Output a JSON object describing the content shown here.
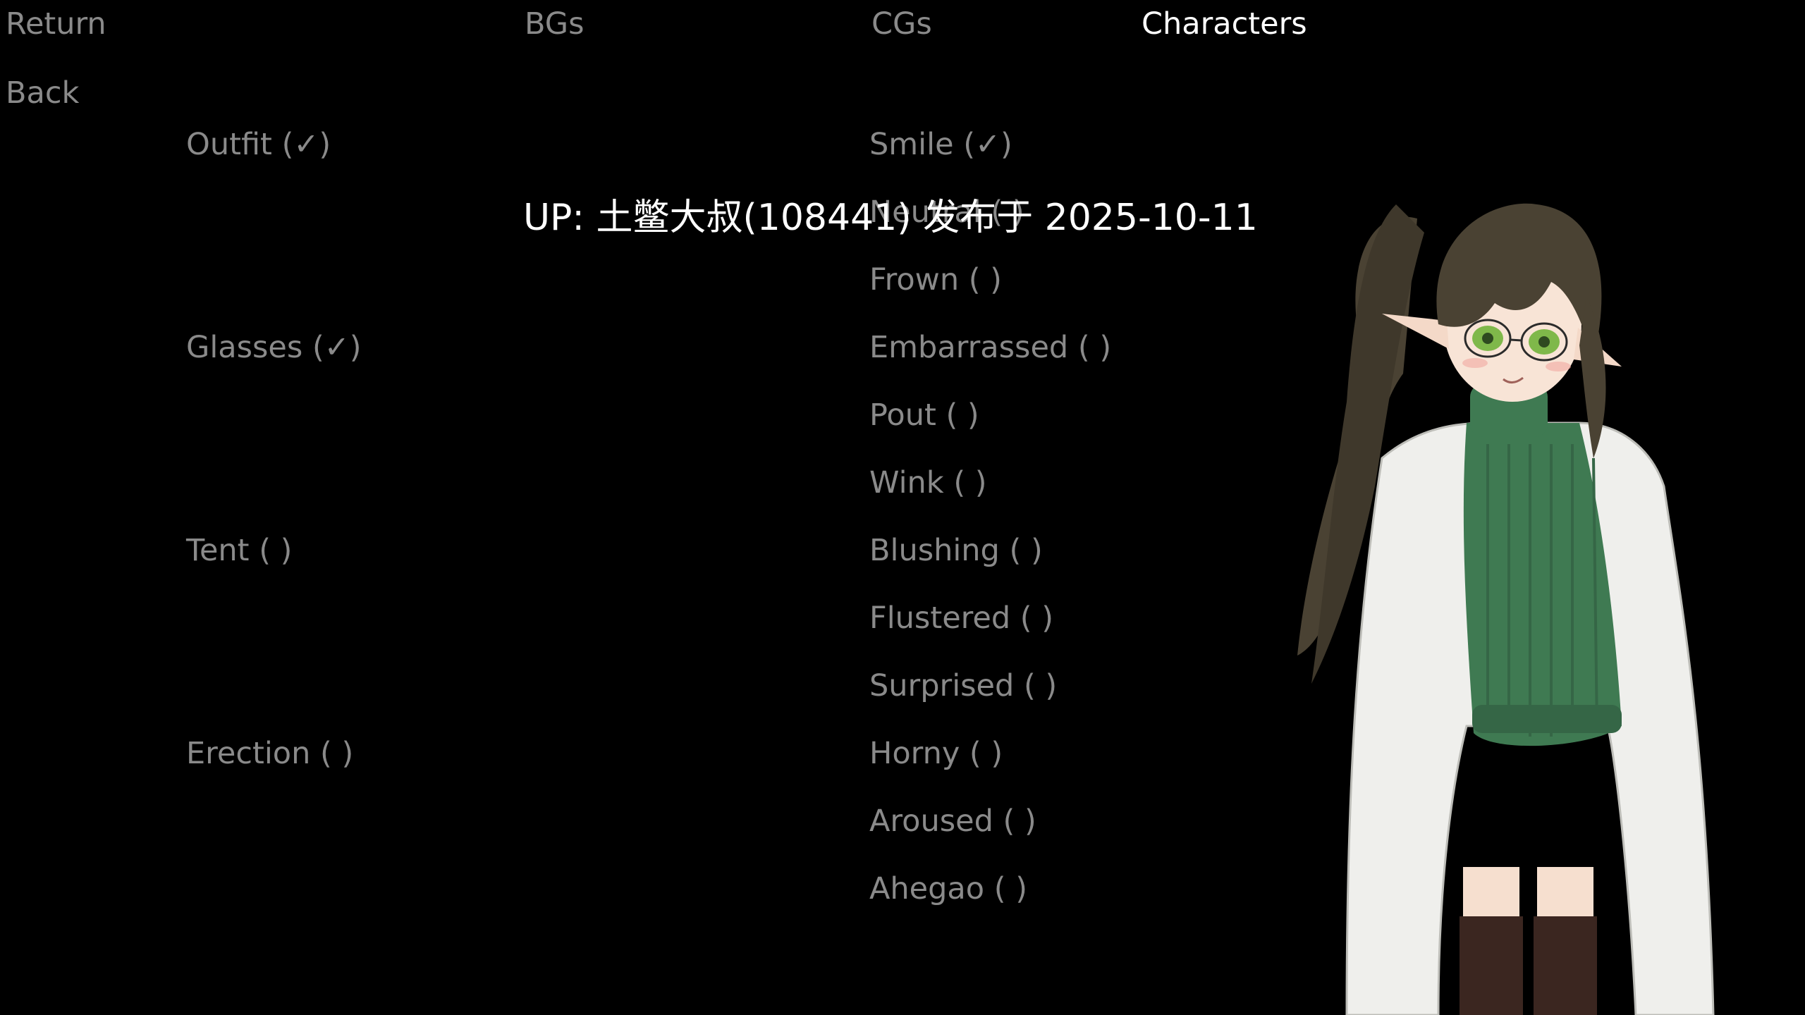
{
  "nav": {
    "return": "Return",
    "bgs": "BGs",
    "cgs": "CGs",
    "characters": "Characters"
  },
  "back": "Back",
  "attributes": [
    {
      "label": "Outfit (✓)"
    },
    {
      "label": "Glasses (✓)"
    },
    {
      "label": "Tent (  )"
    },
    {
      "label": "Erection (  )"
    }
  ],
  "expressions": [
    {
      "label": "Smile (✓)"
    },
    {
      "label": "Neutral (  )"
    },
    {
      "label": "Frown (  )"
    },
    {
      "label": "Embarrassed (  )"
    },
    {
      "label": "Pout (  )"
    },
    {
      "label": "Wink (  )"
    },
    {
      "label": "Blushing (  )"
    },
    {
      "label": "Flustered (  )"
    },
    {
      "label": "Surprised (  )"
    },
    {
      "label": "Horny (  )"
    },
    {
      "label": "Aroused (  )"
    },
    {
      "label": "Ahegao (  )"
    }
  ],
  "overlay": {
    "text": "UP: 土鳖大叔(108441) 发布于 2025-10-11"
  },
  "colors": {
    "background": "#000000",
    "inactive_text": "#8a8a8a",
    "active_text": "#ffffff"
  }
}
